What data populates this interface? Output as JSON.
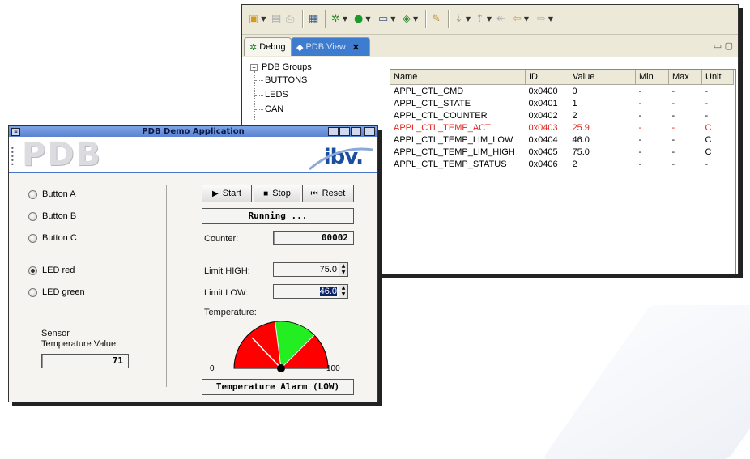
{
  "eclipse": {
    "tabs": [
      {
        "label": "Debug",
        "icon": "debug-bug-icon"
      },
      {
        "label": "PDB View",
        "icon": "pdb-view-icon",
        "close": "✕"
      }
    ],
    "tree": {
      "root": "PDB Groups",
      "children": [
        "BUTTONS",
        "LEDS",
        "CAN"
      ]
    },
    "table": {
      "columns": [
        "Name",
        "ID",
        "Value",
        "Min",
        "Max",
        "Unit"
      ],
      "rows": [
        {
          "name": "APPL_CTL_CMD",
          "id": "0x0400",
          "value": "0",
          "min": "-",
          "max": "-",
          "unit": "-",
          "alarm": false
        },
        {
          "name": "APPL_CTL_STATE",
          "id": "0x0401",
          "value": "1",
          "min": "-",
          "max": "-",
          "unit": "-",
          "alarm": false
        },
        {
          "name": "APPL_CTL_COUNTER",
          "id": "0x0402",
          "value": "2",
          "min": "-",
          "max": "-",
          "unit": "-",
          "alarm": false
        },
        {
          "name": "APPL_CTL_TEMP_ACT",
          "id": "0x0403",
          "value": "25.9",
          "min": "-",
          "max": "-",
          "unit": "C",
          "alarm": true
        },
        {
          "name": "APPL_CTL_TEMP_LIM_LOW",
          "id": "0x0404",
          "value": "46.0",
          "min": "-",
          "max": "-",
          "unit": "C",
          "alarm": false
        },
        {
          "name": "APPL_CTL_TEMP_LIM_HIGH",
          "id": "0x0405",
          "value": "75.0",
          "min": "-",
          "max": "-",
          "unit": "C",
          "alarm": false
        },
        {
          "name": "APPL_CTL_TEMP_STATUS",
          "id": "0x0406",
          "value": "2",
          "min": "-",
          "max": "-",
          "unit": "-",
          "alarm": false
        }
      ]
    },
    "colors": {
      "alarm": "#e1251b",
      "active_tab": "#3e7cd0"
    }
  },
  "pdb_app": {
    "title": "PDB Demo Application",
    "logo_text": "PDB",
    "brand_text": "ibv.",
    "radios": [
      {
        "label": "Button A",
        "checked": false
      },
      {
        "label": "Button B",
        "checked": false
      },
      {
        "label": "Button C",
        "checked": false
      },
      {
        "label": "LED red",
        "checked": true
      },
      {
        "label": "LED green",
        "checked": false
      }
    ],
    "sensor": {
      "label_line1": "Sensor",
      "label_line2": "Temperature Value:",
      "value": "71"
    },
    "buttons": {
      "start": "Start",
      "stop": "Stop",
      "reset": "Reset"
    },
    "status": "Running ...",
    "counter": {
      "label": "Counter:",
      "value": "00002"
    },
    "limit_high": {
      "label": "Limit HIGH:",
      "value": "75.0"
    },
    "limit_low": {
      "label": "Limit LOW:",
      "value": "46.0"
    },
    "temperature": {
      "label": "Temperature:",
      "min_label": "0",
      "max_label": "100",
      "value": 25.9
    },
    "alarm": "Temperature Alarm (LOW)",
    "colors": {
      "gauge_red": "#ff0000",
      "gauge_green": "#22ee22",
      "accent": "#4a76c7"
    }
  }
}
